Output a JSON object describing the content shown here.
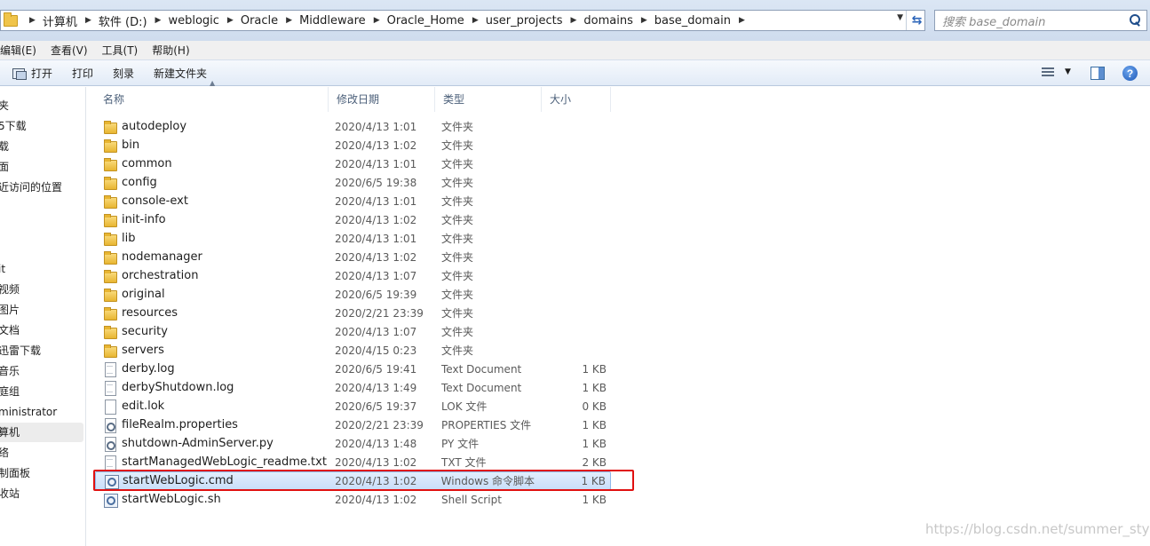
{
  "address": {
    "crumbs": [
      "计算机",
      "软件 (D:)",
      "weblogic",
      "Oracle",
      "Middleware",
      "Oracle_Home",
      "user_projects",
      "domains",
      "base_domain"
    ]
  },
  "search": {
    "placeholder": "搜索 base_domain"
  },
  "menu": [
    "编辑(E)",
    "查看(V)",
    "工具(T)",
    "帮助(H)"
  ],
  "commands": {
    "open": "打开",
    "print": "打印",
    "burn": "刻录",
    "new_folder": "新建文件夹"
  },
  "nav": [
    {
      "label": "夹",
      "selected": false
    },
    {
      "label": "5下载",
      "selected": false
    },
    {
      "label": "载",
      "selected": false
    },
    {
      "label": "面",
      "selected": false
    },
    {
      "label": "近访问的位置",
      "selected": false
    },
    {
      "label": "it",
      "selected": false
    },
    {
      "label": "视频",
      "selected": false
    },
    {
      "label": "图片",
      "selected": false
    },
    {
      "label": "文档",
      "selected": false
    },
    {
      "label": "迅雷下载",
      "selected": false
    },
    {
      "label": "音乐",
      "selected": false
    },
    {
      "label": "庭组",
      "selected": false
    },
    {
      "label": "ministrator",
      "selected": false
    },
    {
      "label": "算机",
      "selected": true
    },
    {
      "label": "络",
      "selected": false
    },
    {
      "label": "制面板",
      "selected": false
    },
    {
      "label": "收站",
      "selected": false
    }
  ],
  "columns": {
    "name": "名称",
    "date": "修改日期",
    "type": "类型",
    "size": "大小"
  },
  "files": [
    {
      "name": "autodeploy",
      "date": "2020/4/13 1:01",
      "type": "文件夹",
      "size": "",
      "icon": "folder"
    },
    {
      "name": "bin",
      "date": "2020/4/13 1:02",
      "type": "文件夹",
      "size": "",
      "icon": "folder"
    },
    {
      "name": "common",
      "date": "2020/4/13 1:01",
      "type": "文件夹",
      "size": "",
      "icon": "folder"
    },
    {
      "name": "config",
      "date": "2020/6/5 19:38",
      "type": "文件夹",
      "size": "",
      "icon": "folder"
    },
    {
      "name": "console-ext",
      "date": "2020/4/13 1:01",
      "type": "文件夹",
      "size": "",
      "icon": "folder"
    },
    {
      "name": "init-info",
      "date": "2020/4/13 1:02",
      "type": "文件夹",
      "size": "",
      "icon": "folder"
    },
    {
      "name": "lib",
      "date": "2020/4/13 1:01",
      "type": "文件夹",
      "size": "",
      "icon": "folder"
    },
    {
      "name": "nodemanager",
      "date": "2020/4/13 1:02",
      "type": "文件夹",
      "size": "",
      "icon": "folder"
    },
    {
      "name": "orchestration",
      "date": "2020/4/13 1:07",
      "type": "文件夹",
      "size": "",
      "icon": "folder"
    },
    {
      "name": "original",
      "date": "2020/6/5 19:39",
      "type": "文件夹",
      "size": "",
      "icon": "folder"
    },
    {
      "name": "resources",
      "date": "2020/2/21 23:39",
      "type": "文件夹",
      "size": "",
      "icon": "folder"
    },
    {
      "name": "security",
      "date": "2020/4/13 1:07",
      "type": "文件夹",
      "size": "",
      "icon": "folder"
    },
    {
      "name": "servers",
      "date": "2020/4/15 0:23",
      "type": "文件夹",
      "size": "",
      "icon": "folder"
    },
    {
      "name": "derby.log",
      "date": "2020/6/5 19:41",
      "type": "Text Document",
      "size": "1 KB",
      "icon": "doc"
    },
    {
      "name": "derbyShutdown.log",
      "date": "2020/4/13 1:49",
      "type": "Text Document",
      "size": "1 KB",
      "icon": "doc"
    },
    {
      "name": "edit.lok",
      "date": "2020/6/5 19:37",
      "type": "LOK 文件",
      "size": "0 KB",
      "icon": "blank"
    },
    {
      "name": "fileRealm.properties",
      "date": "2020/2/21 23:39",
      "type": "PROPERTIES 文件",
      "size": "1 KB",
      "icon": "cfg"
    },
    {
      "name": "shutdown-AdminServer.py",
      "date": "2020/4/13 1:48",
      "type": "PY 文件",
      "size": "1 KB",
      "icon": "cfg"
    },
    {
      "name": "startManagedWebLogic_readme.txt",
      "date": "2020/4/13 1:02",
      "type": "TXT 文件",
      "size": "2 KB",
      "icon": "doc"
    },
    {
      "name": "startWebLogic.cmd",
      "date": "2020/4/13 1:02",
      "type": "Windows 命令脚本",
      "size": "1 KB",
      "icon": "script",
      "highlighted": true
    },
    {
      "name": "startWebLogic.sh",
      "date": "2020/4/13 1:02",
      "type": "Shell Script",
      "size": "1 KB",
      "icon": "script"
    }
  ],
  "watermark": "https://blog.csdn.net/summer_style"
}
